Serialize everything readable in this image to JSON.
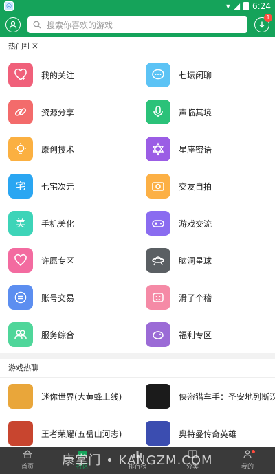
{
  "status_bar": {
    "time": "6:24"
  },
  "header": {
    "search_placeholder": "搜索你喜欢的游戏",
    "download_badge": "1"
  },
  "community": {
    "title": "热门社区",
    "items": [
      {
        "label": "我的关注",
        "icon": "heart-plus-icon",
        "color": "#f0607a"
      },
      {
        "label": "七坛闲聊",
        "icon": "chat-bubble-icon",
        "color": "#5cc3f5"
      },
      {
        "label": "资源分享",
        "icon": "link-icon",
        "color": "#f36b6b"
      },
      {
        "label": "声临其境",
        "icon": "microphone-icon",
        "color": "#2bc279"
      },
      {
        "label": "原创技术",
        "icon": "lightbulb-icon",
        "color": "#fbb041"
      },
      {
        "label": "星座密语",
        "icon": "star-of-david-icon",
        "color": "#9b5de5"
      },
      {
        "label": "七宅次元",
        "icon": "zhai-icon",
        "color": "#2aa6f2"
      },
      {
        "label": "交友自拍",
        "icon": "camera-icon",
        "color": "#fcb045"
      },
      {
        "label": "手机美化",
        "icon": "mei-icon",
        "color": "#3dd4b8"
      },
      {
        "label": "游戏交流",
        "icon": "gamepad-icon",
        "color": "#8a6cf0"
      },
      {
        "label": "许愿专区",
        "icon": "heart-outline-icon",
        "color": "#f36ba0"
      },
      {
        "label": "脑洞星球",
        "icon": "ufo-icon",
        "color": "#5a5f63"
      },
      {
        "label": "账号交易",
        "icon": "exchange-icon",
        "color": "#5c8ef0"
      },
      {
        "label": "滑了个稽",
        "icon": "funny-face-icon",
        "color": "#f58aa6"
      },
      {
        "label": "服务综合",
        "icon": "users-icon",
        "color": "#4fd69a"
      },
      {
        "label": "福利专区",
        "icon": "piggy-bank-icon",
        "color": "#9b6bd6"
      }
    ]
  },
  "games": {
    "title": "游戏热聊",
    "items": [
      {
        "label": "迷你世界(大黄蜂上线)",
        "icon": "mini-world-icon",
        "color": "#e9a63a"
      },
      {
        "label": "侠盗猎车手：圣安地列斯汉",
        "icon": "gta-icon",
        "color": "#1b1b1b"
      },
      {
        "label": "王者荣耀(五岳山河志)",
        "icon": "honor-of-kings-icon",
        "color": "#c8452f"
      },
      {
        "label": "奥特曼传奇英雄",
        "icon": "ultraman-icon",
        "color": "#3b4db0"
      }
    ]
  },
  "bottom_nav": [
    {
      "label": "首页",
      "icon": "home-icon"
    },
    {
      "label": "社区",
      "icon": "community-icon"
    },
    {
      "label": "排行榜",
      "icon": "ranking-icon"
    },
    {
      "label": "分类",
      "icon": "category-icon"
    },
    {
      "label": "我的",
      "icon": "profile-icon"
    }
  ],
  "watermark": "康掌门 • KANGZM.COM"
}
